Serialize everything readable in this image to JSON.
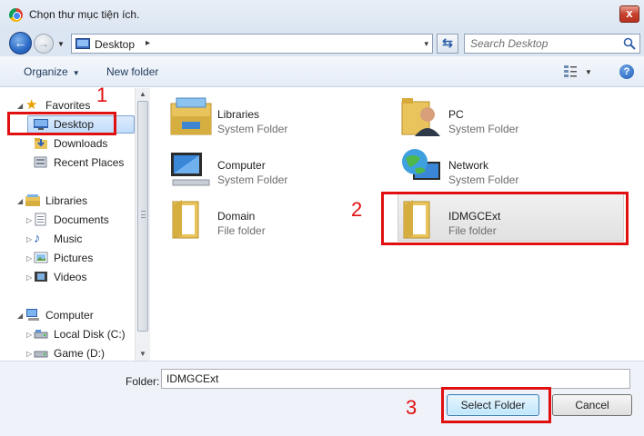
{
  "window": {
    "title": "Chọn thư mục tiện ích.",
    "close_label": "x"
  },
  "address_bar": {
    "path": "Desktop",
    "separator": "▸",
    "dropdown": "▾"
  },
  "search": {
    "placeholder": "Search Desktop"
  },
  "toolbar": {
    "organize": "Organize",
    "new_folder": "New folder",
    "help": "?"
  },
  "nav": {
    "favorites": "Favorites",
    "desktop": "Desktop",
    "downloads": "Downloads",
    "recent_places": "Recent Places",
    "libraries": "Libraries",
    "documents": "Documents",
    "music": "Music",
    "pictures": "Pictures",
    "videos": "Videos",
    "computer": "Computer",
    "local_disk": "Local Disk (C:)",
    "game": "Game (D:)"
  },
  "items": [
    {
      "name": "Libraries",
      "type": "System Folder"
    },
    {
      "name": "PC",
      "type": "System Folder"
    },
    {
      "name": "Computer",
      "type": "System Folder"
    },
    {
      "name": "Network",
      "type": "System Folder"
    },
    {
      "name": "Domain",
      "type": "File folder"
    },
    {
      "name": "IDMGCExt",
      "type": "File folder"
    }
  ],
  "bottom": {
    "folder_label": "Folder:",
    "folder_value": "IDMGCExt",
    "select_button": "Select Folder",
    "cancel_button": "Cancel"
  },
  "annotations": {
    "step1": "1",
    "step2": "2",
    "step3": "3",
    "color": "#e01010"
  }
}
